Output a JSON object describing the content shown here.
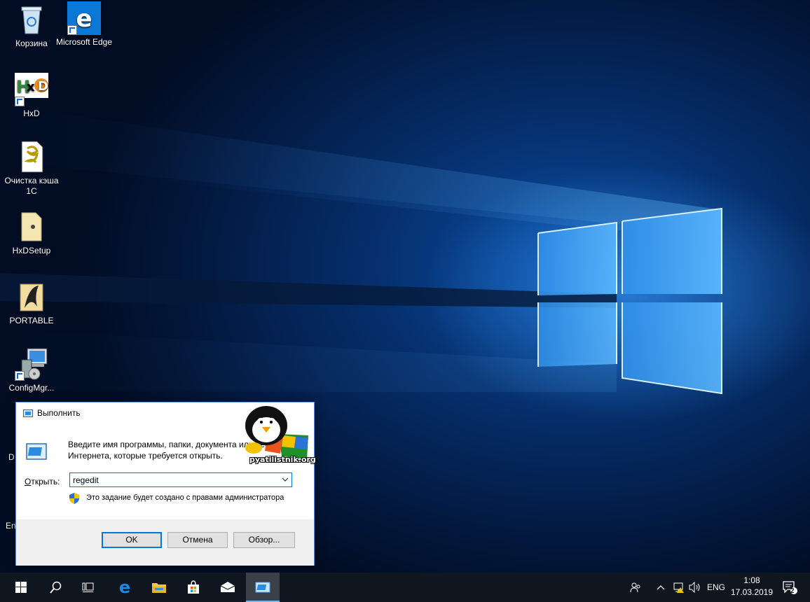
{
  "desktop": {
    "icons": [
      {
        "label": "Корзина",
        "icon": "recycle-bin-icon"
      },
      {
        "label": "Microsoft Edge",
        "icon": "edge-icon"
      },
      {
        "label": "HxD",
        "icon": "hxd-icon"
      },
      {
        "label": "Очистка кэша 1С",
        "icon": "script-file-icon"
      },
      {
        "label": "HxDSetup",
        "icon": "setup-file-icon"
      },
      {
        "label": "PORTABLE",
        "icon": "portable-folder-icon"
      },
      {
        "label": "ConfigMgr...",
        "icon": "configmgr-icon"
      }
    ],
    "cropped_left": [
      "D",
      "En"
    ]
  },
  "run_dialog": {
    "title": "Выполнить",
    "description_line1": "Введите имя программы, папки, документа или ресурса",
    "description_line2": "Интернета, которые требуется открыть.",
    "open_label_underlined": "О",
    "open_label_rest": "ткрыть:",
    "input_value": "regedit",
    "admin_note": "Это задание будет создано с правами администратора",
    "ok_label": "OK",
    "cancel_label": "Отмена",
    "browse_label": "Обзор...",
    "accent": "#0078d7"
  },
  "watermark": {
    "text": "pyatilistnik.org"
  },
  "taskbar": {
    "pinned": [
      "start-icon",
      "search-icon",
      "task-view-icon",
      "edge-icon",
      "file-explorer-icon",
      "store-icon",
      "mail-icon",
      "run-icon"
    ],
    "tray": {
      "language": "ENG",
      "time": "1:08",
      "date": "17.03.2019",
      "notification_count": "2"
    }
  }
}
